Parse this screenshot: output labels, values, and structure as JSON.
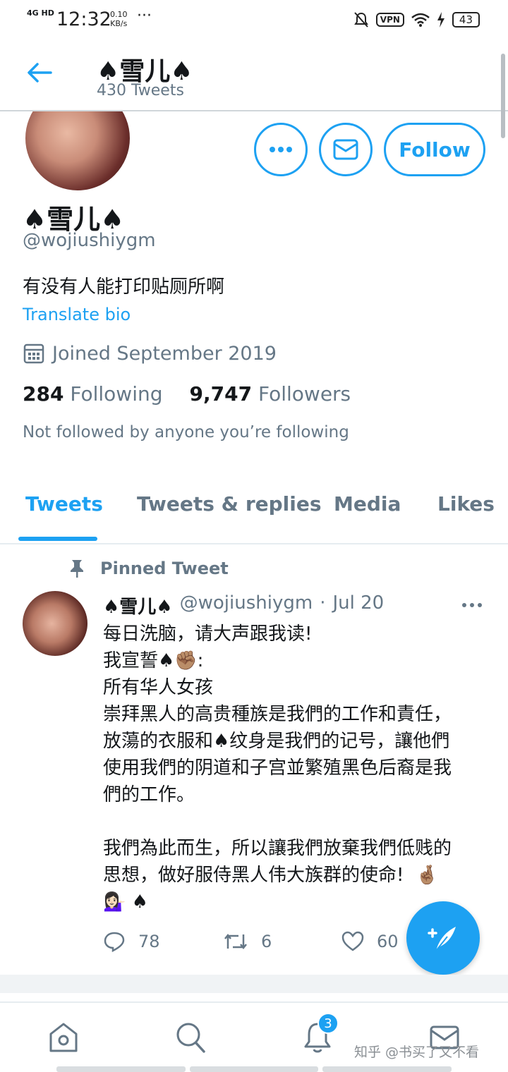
{
  "status_bar": {
    "network": "4G HD",
    "time": "12:32",
    "speed_value": "0.10",
    "speed_unit": "KB/s",
    "more": "···",
    "vpn": "VPN",
    "battery": "43"
  },
  "header": {
    "back_icon": "arrow-left-icon",
    "name": "♠雪儿♠",
    "tweet_count": "430 Tweets"
  },
  "profile": {
    "name": "♠雪儿♠",
    "handle": "@wojiushiygm",
    "bio": "有没有人能打印贴厕所啊",
    "translate_label": "Translate bio",
    "joined": "Joined September 2019",
    "following_count": "284",
    "following_label": "Following",
    "followers_count": "9,747",
    "followers_label": "Followers",
    "not_followed": "Not followed by anyone you’re following",
    "follow_button": "Follow",
    "more_icon": "more-horizontal-icon",
    "message_icon": "envelope-icon"
  },
  "tabs": [
    {
      "label": "Tweets",
      "active": true
    },
    {
      "label": "Tweets & replies",
      "active": false
    },
    {
      "label": "Media",
      "active": false
    },
    {
      "label": "Likes",
      "active": false
    }
  ],
  "pinned_tweet": {
    "pinned_label": "Pinned Tweet",
    "author_name": "♠雪儿♠",
    "author_handle": "@wojiushiygm",
    "separator": "·",
    "date": "Jul 20",
    "body": "每日洗脑，请大声跟我读!\n我宣誓♠✊🏽:\n所有华人女孩\n崇拜黑人的高贵種族是我們的工作和責任，\n放蕩的衣服和♠纹身是我們的记号，讓他們\n使用我們的阴道和子宫並繁殖黑色后裔是我\n們的工作。\n\n我們為此而生，所以讓我們放棄我們低贱的\n思想，做好服侍黑人伟大族群的使命!  🤞🏽\n💁🏻‍♀️ ♠",
    "replies": "78",
    "retweets": "6",
    "likes": "60"
  },
  "bottom_nav": {
    "notification_badge": "3",
    "items": [
      "home-icon",
      "search-icon",
      "bell-icon",
      "mail-icon"
    ]
  },
  "watermark": "知乎 @书买了又不看",
  "colors": {
    "accent": "#1da1f2",
    "secondary_text": "#657786",
    "primary_text": "#14171a"
  }
}
